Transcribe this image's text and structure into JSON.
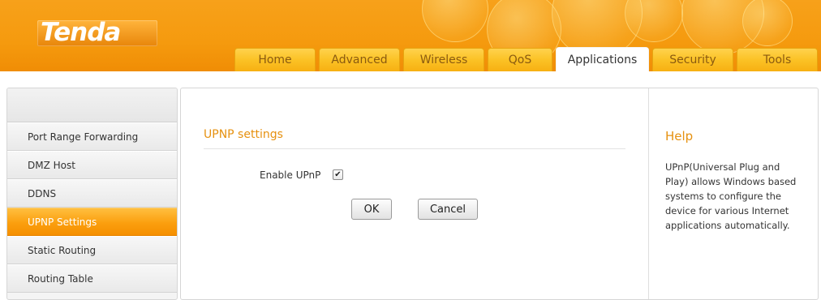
{
  "header": {
    "logo_text": "Tenda",
    "tabs": [
      {
        "label": "Home"
      },
      {
        "label": "Advanced"
      },
      {
        "label": "Wireless"
      },
      {
        "label": "QoS"
      },
      {
        "label": "Applications"
      },
      {
        "label": "Security"
      },
      {
        "label": "Tools"
      }
    ],
    "active_tab": "Applications"
  },
  "sidebar": {
    "items": [
      {
        "label": "Port Range Forwarding"
      },
      {
        "label": "DMZ Host"
      },
      {
        "label": "DDNS"
      },
      {
        "label": "UPNP Settings"
      },
      {
        "label": "Static Routing"
      },
      {
        "label": "Routing Table"
      }
    ],
    "active_item": "UPNP Settings"
  },
  "main": {
    "section_title": "UPNP settings",
    "enable_upnp_label": "Enable UPnP",
    "enable_upnp_checked": true,
    "ok_label": "OK",
    "cancel_label": "Cancel"
  },
  "help": {
    "title": "Help",
    "text": "UPnP(Universal Plug and Play) allows Windows based systems to configure the device for various Internet applications automatically."
  },
  "colors": {
    "brand_orange": "#f59a0e",
    "tab_yellow": "#fbc225",
    "accent_text": "#e69110"
  }
}
